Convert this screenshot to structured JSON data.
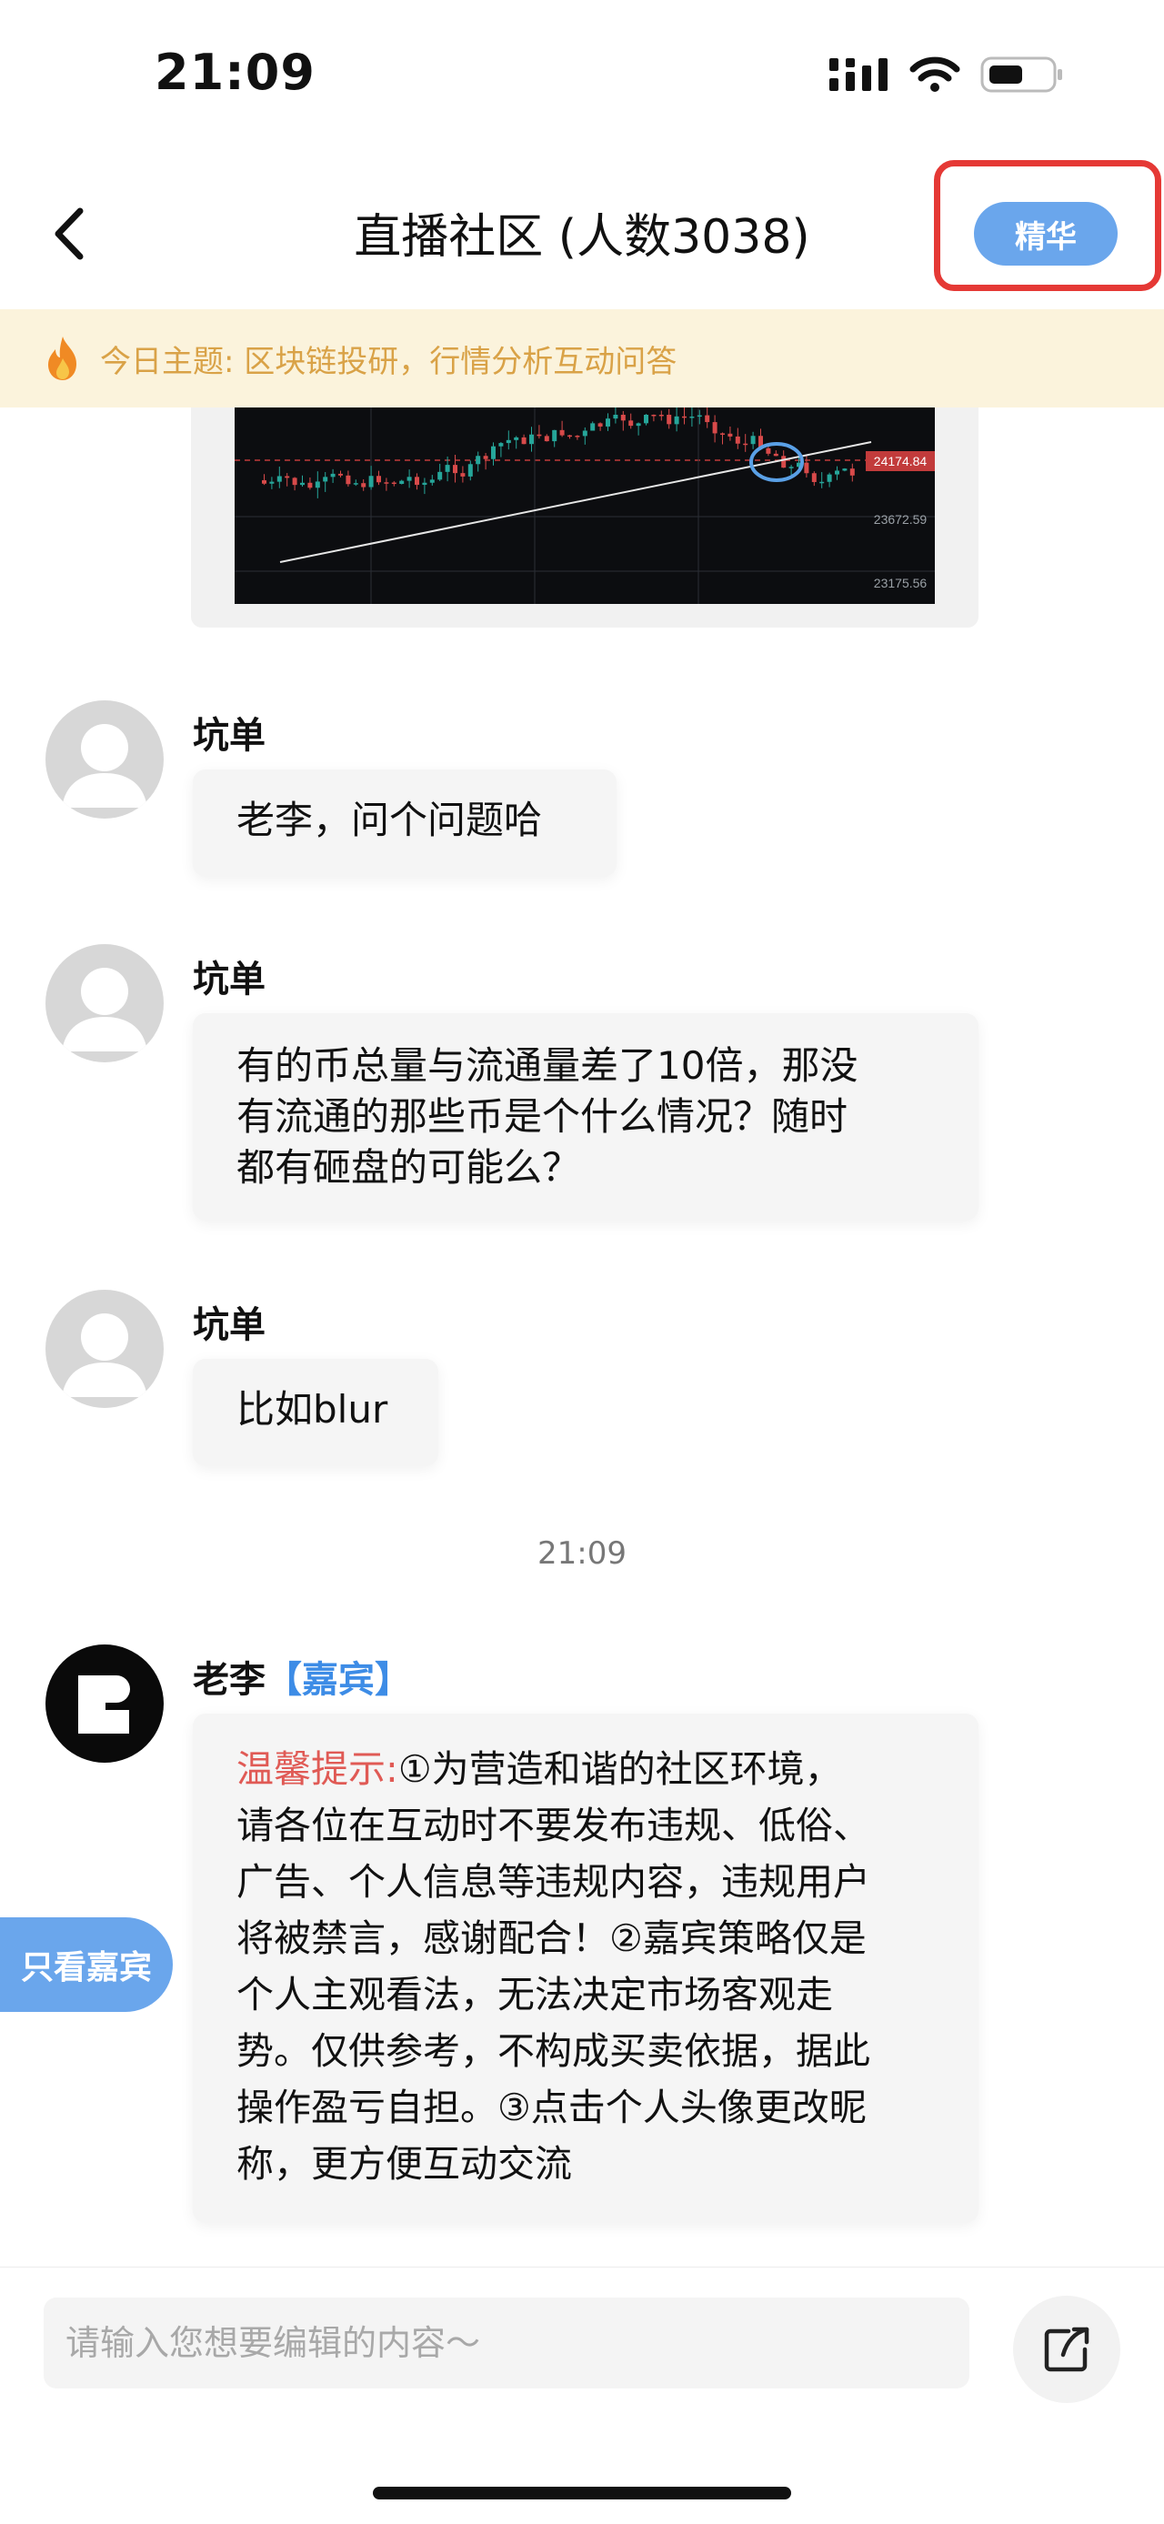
{
  "status_bar": {
    "time": "21:09"
  },
  "header": {
    "title": "直播社区 (人数3038)",
    "essence_button": "精华"
  },
  "topic": {
    "text": "今日主题: 区块链投研，行情分析互动问答"
  },
  "chart_image": {
    "price_labels": [
      "24174.84",
      "23672.59",
      "23175.56"
    ]
  },
  "messages": [
    {
      "user": "坑单",
      "text": "老李，问个问题哈"
    },
    {
      "user": "坑单",
      "text_lines": [
        "有的币总量与流通量差了10倍，那没",
        "有流通的那些币是个什么情况？随时",
        "都有砸盘的可能么？"
      ]
    },
    {
      "user": "坑单",
      "text": "比如blur"
    }
  ],
  "timestamp": "21:09",
  "host_message": {
    "user": "老李",
    "tag": "【嘉宾】",
    "label": "温馨提示:",
    "lines": [
      "①为营造和谐的社区环境，",
      "请各位在互动时不要发布违规、低俗、",
      "广告、个人信息等违规内容，违规用户",
      "将被禁言，感谢配合！②嘉宾策略仅是",
      "个人主观看法，无法决定市场客观走",
      "势。仅供参考，不构成买卖依据，据此",
      "操作盈亏自担。③点击个人头像更改昵",
      "称，更方便互动交流"
    ]
  },
  "only_guest_button": "只看嘉宾",
  "input": {
    "placeholder": "请输入您想要编辑的内容～"
  },
  "colors": {
    "accent": "#6aa6ec",
    "highlight_border": "#e53935",
    "topic_bg": "#fbf3dc",
    "warn": "#e05a55"
  }
}
